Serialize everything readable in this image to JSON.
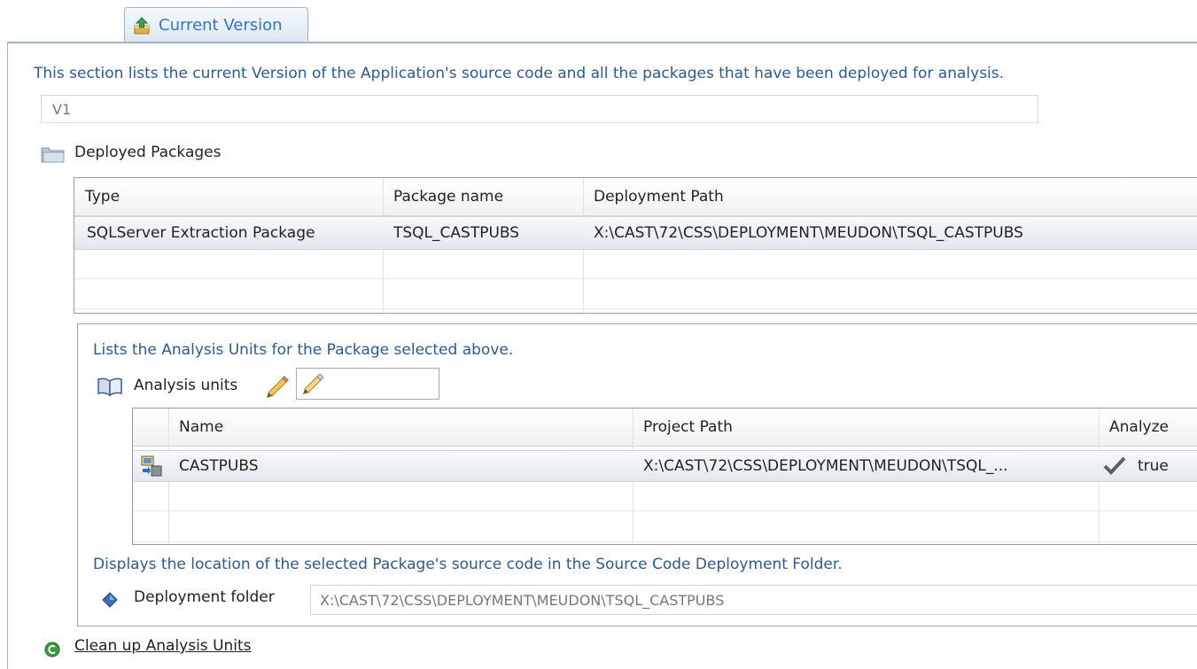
{
  "tab": {
    "label": "Current Version",
    "icon": "upload-box-icon"
  },
  "description": "This section lists the current Version of the Application's source code and all the packages that have been deployed for analysis.",
  "version": {
    "value": "V1"
  },
  "deployed_packages": {
    "title": "Deployed Packages",
    "columns": [
      "Type",
      "Package name",
      "Deployment Path"
    ],
    "rows": [
      {
        "type": "SQLServer Extraction Package",
        "name": "TSQL_CASTPUBS",
        "path": "X:\\CAST\\72\\CSS\\DEPLOYMENT\\MEUDON\\TSQL_CASTPUBS"
      }
    ]
  },
  "analysis_units": {
    "description": "Lists the Analysis Units for the Package selected above.",
    "title": "Analysis units",
    "filter_value": "",
    "columns": [
      "Name",
      "Project Path",
      "Analyze"
    ],
    "rows": [
      {
        "name": "CASTPUBS",
        "path": "X:\\CAST\\72\\CSS\\DEPLOYMENT\\MEUDON\\TSQL_...",
        "analyze": "true"
      }
    ]
  },
  "deployment": {
    "description": "Displays the location of the selected Package's source code in the Source Code Deployment Folder.",
    "label": "Deployment folder",
    "value": "X:\\CAST\\72\\CSS\\DEPLOYMENT\\MEUDON\\TSQL_CASTPUBS"
  },
  "cleanup": {
    "label": "Clean up Analysis Units"
  },
  "colors": {
    "accent": "#3a73b8",
    "description_text": "#2d5a90",
    "border": "#9fb3c8"
  }
}
